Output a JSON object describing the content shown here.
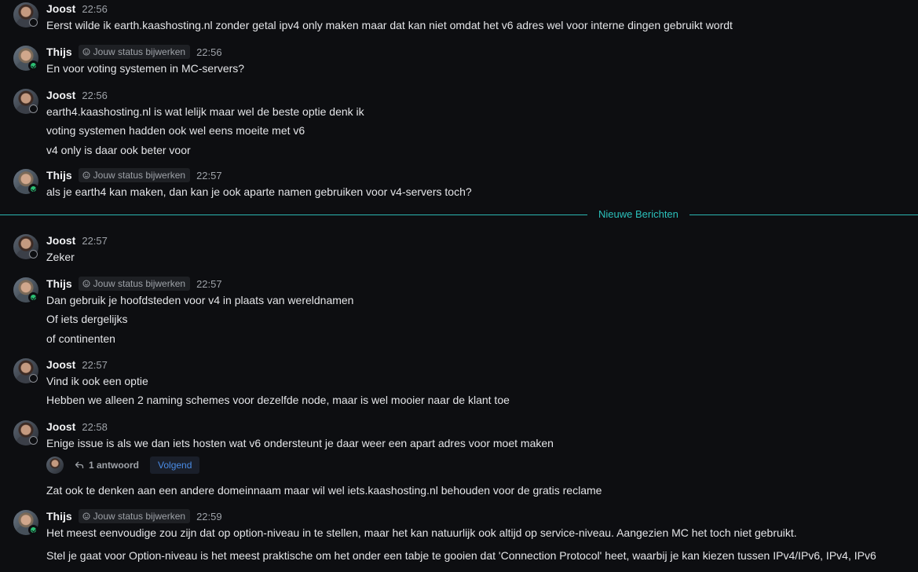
{
  "chat": {
    "divider_label": "Nieuwe Berichten",
    "status_pill_label": "Jouw status bijwerken",
    "groups": [
      {
        "author": "Joost",
        "time": "22:56",
        "has_pill": false,
        "online": false,
        "lines": [
          "Eerst wilde ik earth.kaashosting.nl zonder getal ipv4 only maken maar dat kan niet omdat het v6 adres wel voor interne dingen gebruikt wordt"
        ]
      },
      {
        "author": "Thijs",
        "time": "22:56",
        "has_pill": true,
        "online": true,
        "lines": [
          "En voor voting systemen in MC-servers?"
        ]
      },
      {
        "author": "Joost",
        "time": "22:56",
        "has_pill": false,
        "online": false,
        "lines": [
          "earth4.kaashosting.nl is wat lelijk maar wel de beste optie denk ik",
          "voting systemen hadden ook wel eens moeite met v6",
          "v4 only is daar ook beter voor"
        ]
      },
      {
        "author": "Thijs",
        "time": "22:57",
        "has_pill": true,
        "online": true,
        "lines": [
          "als je earth4 kan maken, dan kan je ook aparte namen gebruiken voor v4-servers toch?"
        ]
      },
      {
        "author": "Joost",
        "time": "22:57",
        "has_pill": false,
        "online": false,
        "lines": [
          "Zeker"
        ]
      },
      {
        "author": "Thijs",
        "time": "22:57",
        "has_pill": true,
        "online": true,
        "lines": [
          "Dan gebruik je hoofdsteden voor v4 in plaats van wereldnamen",
          "Of iets dergelijks",
          "of continenten"
        ]
      },
      {
        "author": "Joost",
        "time": "22:57",
        "has_pill": false,
        "online": false,
        "lines": [
          "Vind ik ook een optie",
          "Hebben we alleen 2 naming schemes voor dezelfde node, maar is wel mooier naar de klant toe"
        ]
      },
      {
        "author": "Joost",
        "time": "22:58",
        "has_pill": false,
        "online": false,
        "lines": [
          "Enige issue is als we dan iets hosten wat v6 ondersteunt je daar weer een apart adres voor moet maken",
          "Zat ook te denken aan een andere domeinnaam maar wil wel iets.kaashosting.nl behouden voor de gratis reclame"
        ],
        "thread": {
          "reply_count": "1 antwoord",
          "follow_label": "Volgend"
        }
      },
      {
        "author": "Thijs",
        "time": "22:59",
        "has_pill": true,
        "online": true,
        "lines": [
          "Het meest eenvoudige zou zijn dat op option-niveau in te stellen, maar het kan natuurlijk ook altijd op service-niveau. Aangezien MC het toch niet gebruikt.",
          "Stel je gaat voor Option-niveau is het meest praktische om het onder een tabje te gooien dat 'Connection Protocol' heet, waarbij je kan kiezen tussen IPv4/IPv6, IPv4, IPv6"
        ]
      }
    ]
  },
  "colors": {
    "background": "#0d0e11",
    "divider": "#2bb5b0",
    "online": "#2bbf73",
    "follow_text": "#4a8ce6"
  }
}
